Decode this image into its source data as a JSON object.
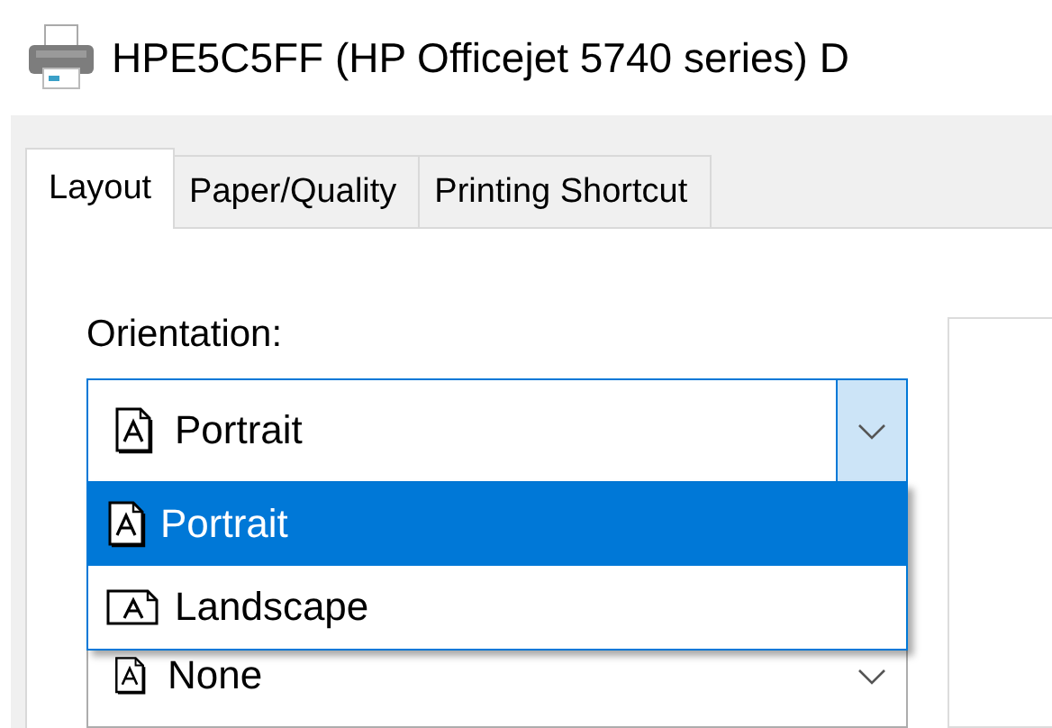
{
  "window": {
    "title": "HPE5C5FF (HP Officejet 5740 series) D"
  },
  "tabs": [
    {
      "label": "Layout",
      "selected": true
    },
    {
      "label": "Paper/Quality",
      "selected": false
    },
    {
      "label": "Printing Shortcut",
      "selected": false
    }
  ],
  "orientation": {
    "label": "Orientation:",
    "value": "Portrait",
    "expanded": true,
    "options": [
      {
        "label": "Portrait",
        "selected": true
      },
      {
        "label": "Landscape",
        "selected": false
      }
    ]
  },
  "second_combo": {
    "value": "None"
  }
}
